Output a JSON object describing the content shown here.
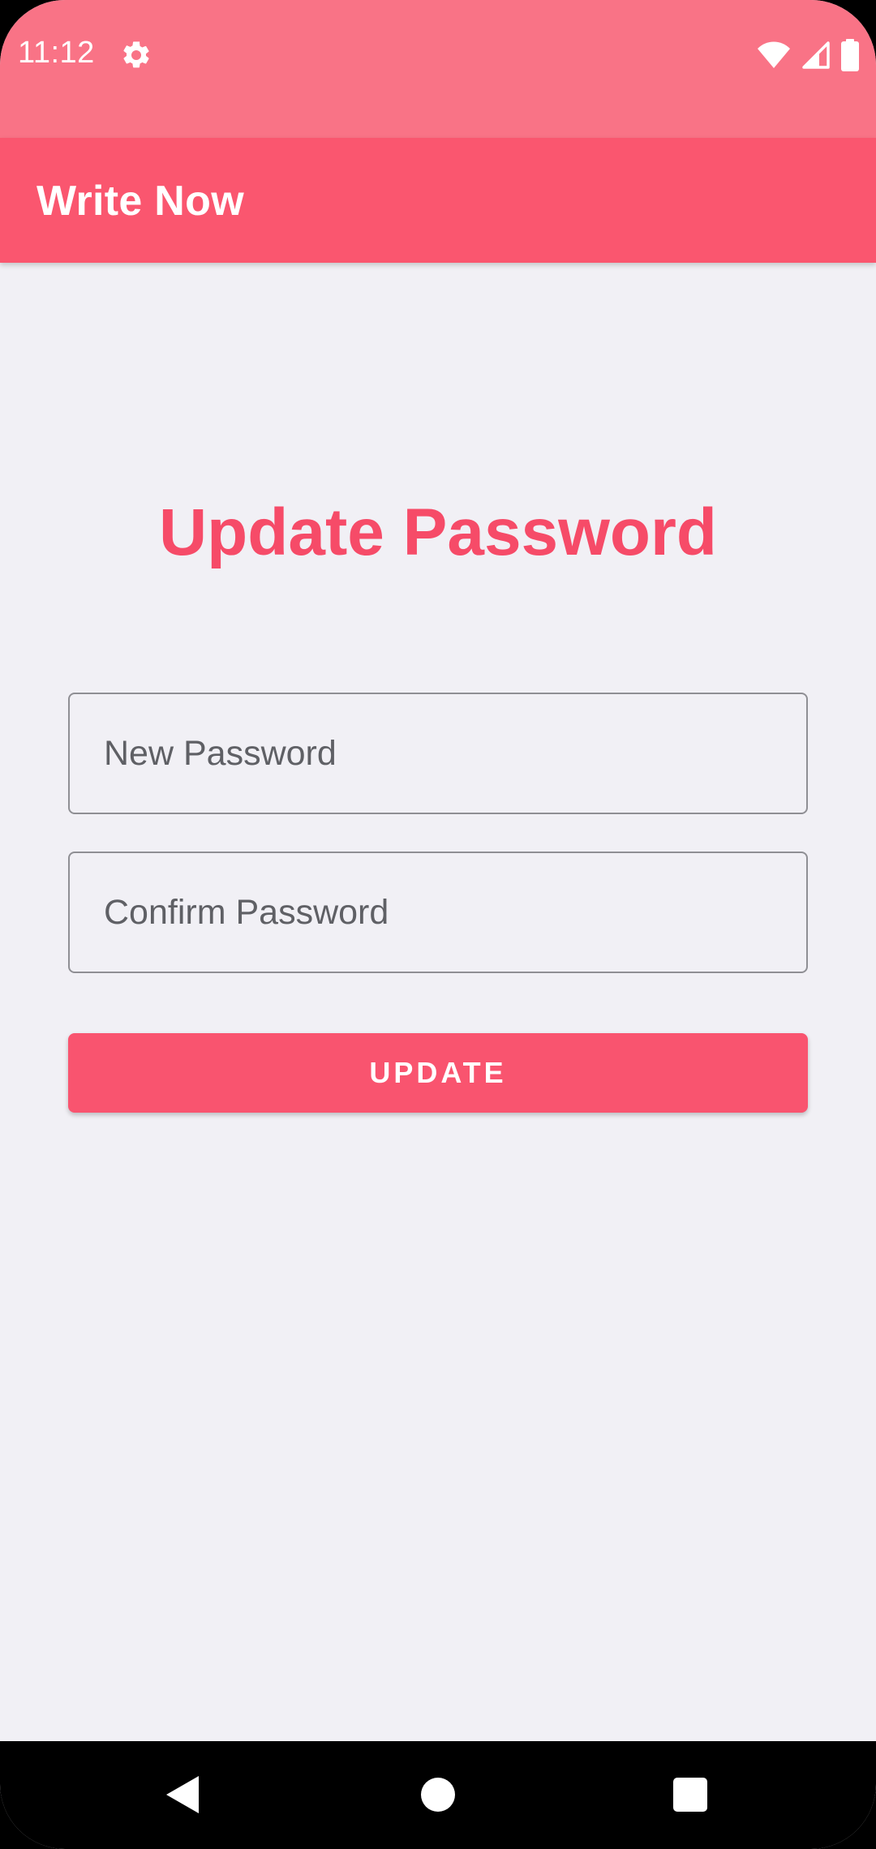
{
  "status_bar": {
    "time": "11:12",
    "icons": [
      "gear-icon",
      "wifi-icon",
      "signal-icon",
      "battery-icon"
    ]
  },
  "app_bar": {
    "title": "Write Now"
  },
  "main": {
    "heading": "Update Password",
    "new_password": {
      "value": "",
      "placeholder": "New Password"
    },
    "confirm_password": {
      "value": "",
      "placeholder": "Confirm Password"
    },
    "update_label": "UPDATE"
  },
  "nav_bar": {
    "icons": [
      "back-icon",
      "home-icon",
      "recents-icon"
    ]
  },
  "colors": {
    "status_bar": "#f97386",
    "app_bar": "#fa566f",
    "accent": "#f64b68",
    "background": "#f1f0f5",
    "field_border": "#8f8f94"
  }
}
